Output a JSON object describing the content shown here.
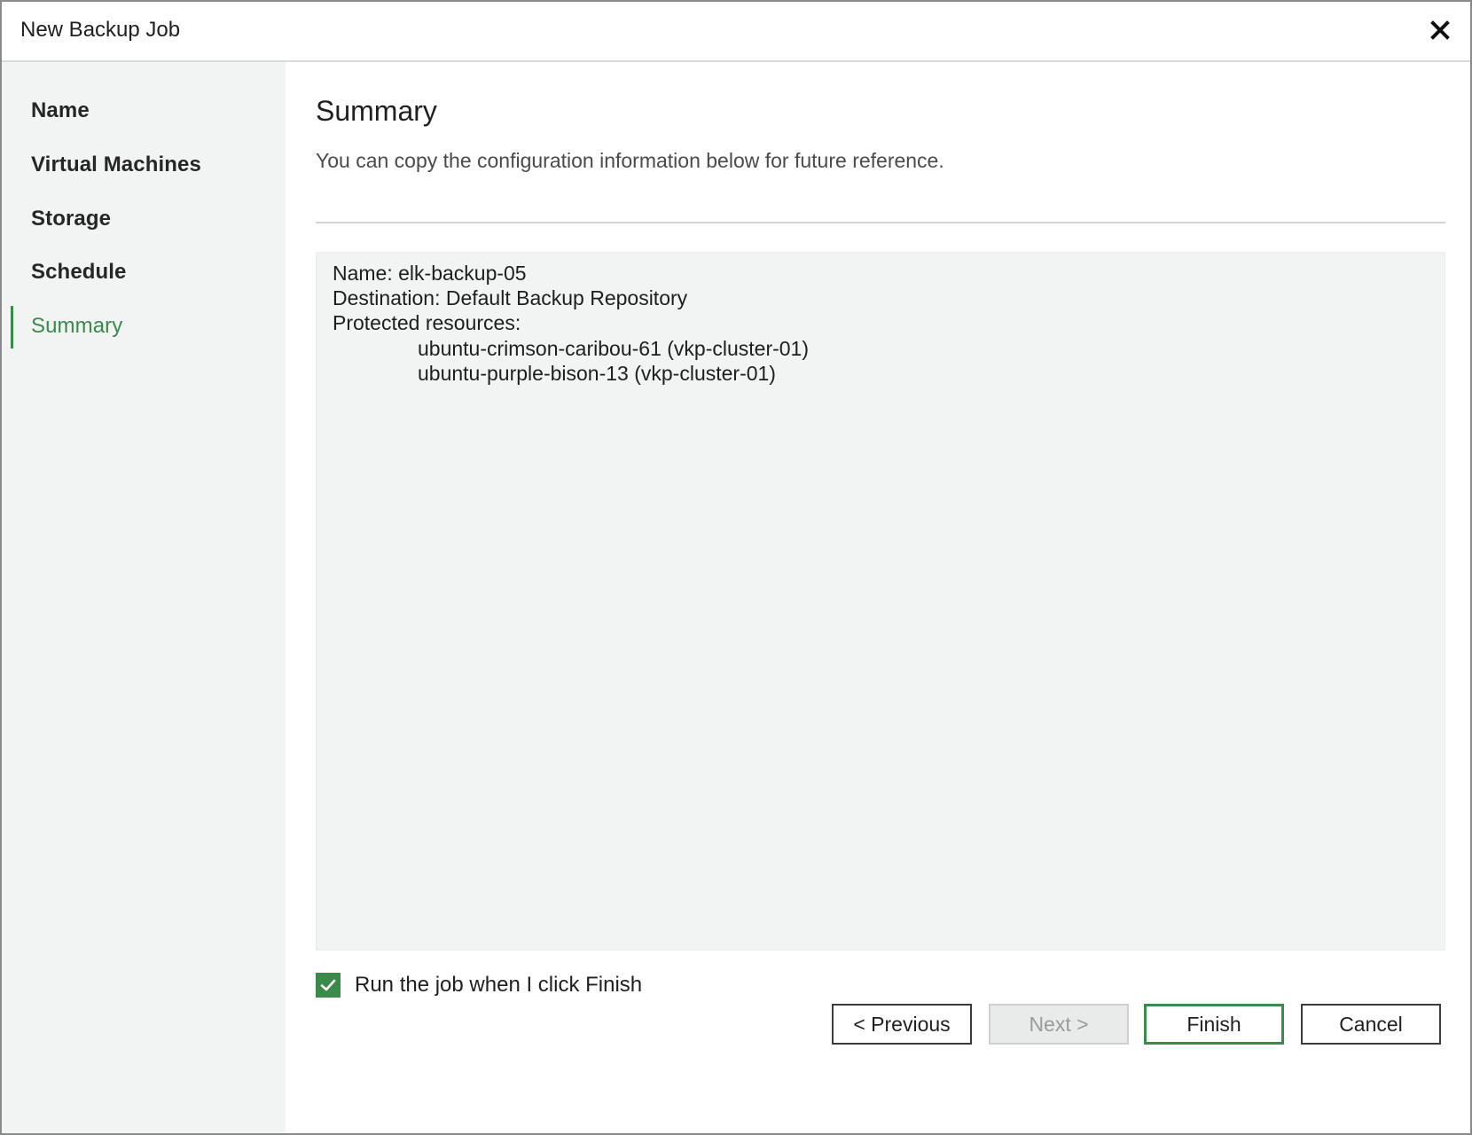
{
  "window": {
    "title": "New Backup Job",
    "close_icon": "close-icon"
  },
  "sidebar": {
    "items": [
      {
        "label": "Name",
        "active": false
      },
      {
        "label": "Virtual Machines",
        "active": false
      },
      {
        "label": "Storage",
        "active": false
      },
      {
        "label": "Schedule",
        "active": false
      },
      {
        "label": "Summary",
        "active": true
      }
    ]
  },
  "main": {
    "title": "Summary",
    "subtitle": "You can copy the configuration information below for future reference.",
    "summary": {
      "name_line": "Name: elk-backup-05",
      "destination_line": "Destination: Default Backup Repository",
      "resources_header": "Protected resources:",
      "resources": [
        "ubuntu-crimson-caribou-61 (vkp-cluster-01)",
        "ubuntu-purple-bison-13 (vkp-cluster-01)"
      ]
    },
    "run_job_checkbox": {
      "label": "Run the job when I click Finish",
      "checked": true
    }
  },
  "buttons": {
    "previous": "< Previous",
    "next": "Next >",
    "finish": "Finish",
    "cancel": "Cancel"
  },
  "colors": {
    "accent": "#3a8a4a",
    "sidebar_bg": "#f2f3f3",
    "summary_bg": "#f2f3f3"
  }
}
